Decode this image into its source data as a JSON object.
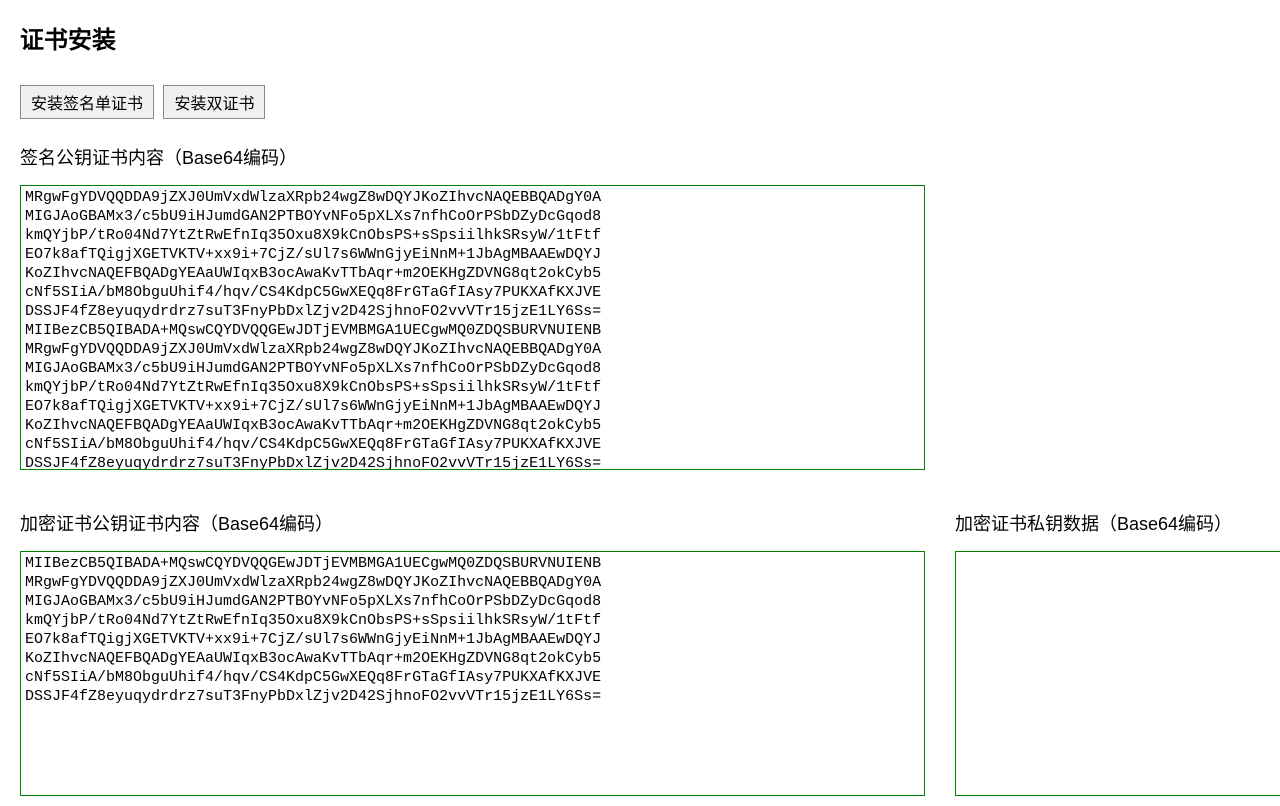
{
  "page": {
    "title": "证书安装"
  },
  "buttons": {
    "install_single": "安装签名单证书",
    "install_double": "安装双证书"
  },
  "sections": {
    "sign_cert_label": "签名公钥证书内容（Base64编码）",
    "enc_cert_label": "加密证书公钥证书内容（Base64编码）",
    "enc_key_label": "加密证书私钥数据（Base64编码）"
  },
  "values": {
    "sign_cert": "MRgwFgYDVQQDDA9jZXJ0UmVxdWlzaXRpb24wgZ8wDQYJKoZIhvcNAQEBBQADgY0A\nMIGJAoGBAMx3/c5bU9iHJumdGAN2PTBOYvNFo5pXLXs7nfhCoOrPSbDZyDcGqod8\nkmQYjbP/tRo04Nd7YtZtRwEfnIq35Oxu8X9kCnObsPS+sSpsiilhkSRsyW/1tFtf\nEO7k8afTQigjXGETVKTV+xx9i+7CjZ/sUl7s6WWnGjyEiNnM+1JbAgMBAAEwDQYJ\nKoZIhvcNAQEFBQADgYEAaUWIqxB3ocAwaKvTTbAqr+m2OEKHgZDVNG8qt2okCyb5\ncNf5SIiA/bM8ObguUhif4/hqv/CS4KdpC5GwXEQq8FrGTaGfIAsy7PUKXAfKXJVE\nDSSJF4fZ8eyuqydrdrz7suT3FnyPbDxlZjv2D42SjhnoFO2vvVTr15jzE1LY6Ss=\nMIIBezCB5QIBADA+MQswCQYDVQQGEwJDTjEVMBMGA1UECgwMQ0ZDQSBURVNUIENB\nMRgwFgYDVQQDDA9jZXJ0UmVxdWlzaXRpb24wgZ8wDQYJKoZIhvcNAQEBBQADgY0A\nMIGJAoGBAMx3/c5bU9iHJumdGAN2PTBOYvNFo5pXLXs7nfhCoOrPSbDZyDcGqod8\nkmQYjbP/tRo04Nd7YtZtRwEfnIq35Oxu8X9kCnObsPS+sSpsiilhkSRsyW/1tFtf\nEO7k8afTQigjXGETVKTV+xx9i+7CjZ/sUl7s6WWnGjyEiNnM+1JbAgMBAAEwDQYJ\nKoZIhvcNAQEFBQADgYEAaUWIqxB3ocAwaKvTTbAqr+m2OEKHgZDVNG8qt2okCyb5\ncNf5SIiA/bM8ObguUhif4/hqv/CS4KdpC5GwXEQq8FrGTaGfIAsy7PUKXAfKXJVE\nDSSJF4fZ8eyuqydrdrz7suT3FnyPbDxlZjv2D42SjhnoFO2vvVTr15jzE1LY6Ss=",
    "enc_cert": "MIIBezCB5QIBADA+MQswCQYDVQQGEwJDTjEVMBMGA1UECgwMQ0ZDQSBURVNUIENB\nMRgwFgYDVQQDDA9jZXJ0UmVxdWlzaXRpb24wgZ8wDQYJKoZIhvcNAQEBBQADgY0A\nMIGJAoGBAMx3/c5bU9iHJumdGAN2PTBOYvNFo5pXLXs7nfhCoOrPSbDZyDcGqod8\nkmQYjbP/tRo04Nd7YtZtRwEfnIq35Oxu8X9kCnObsPS+sSpsiilhkSRsyW/1tFtf\nEO7k8afTQigjXGETVKTV+xx9i+7CjZ/sUl7s6WWnGjyEiNnM+1JbAgMBAAEwDQYJ\nKoZIhvcNAQEFBQADgYEAaUWIqxB3ocAwaKvTTbAqr+m2OEKHgZDVNG8qt2okCyb5\ncNf5SIiA/bM8ObguUhif4/hqv/CS4KdpC5GwXEQq8FrGTaGfIAsy7PUKXAfKXJVE\nDSSJF4fZ8eyuqydrdrz7suT3FnyPbDxlZjv2D42SjhnoFO2vvVTr15jzE1LY6Ss=",
    "enc_key": ""
  }
}
